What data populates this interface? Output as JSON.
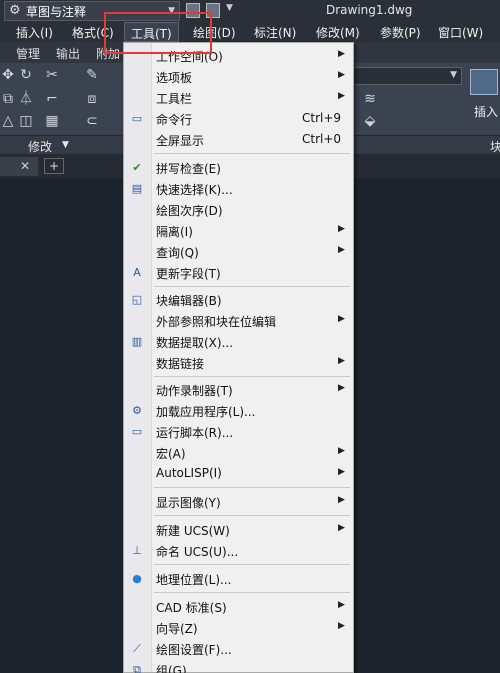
{
  "titlebar": {
    "workspace": "草图与注释",
    "document_title": "Drawing1.dwg"
  },
  "menubar": {
    "items": [
      "插入(I)",
      "格式(C)",
      "工具(T)",
      "绘图(D)",
      "标注(N)",
      "修改(M)",
      "参数(P)",
      "窗口(W)"
    ]
  },
  "ribbon_tabs": [
    "管理",
    "输出",
    "附加"
  ],
  "ribbon": {
    "panel_label": "修改",
    "insert_label": "插入",
    "right_panel_label": "块"
  },
  "tools_menu": {
    "items": [
      {
        "label": "工作空间(O)",
        "submenu": true
      },
      {
        "label": "选项板",
        "submenu": true
      },
      {
        "label": "工具栏",
        "submenu": true
      },
      {
        "label": "命令行",
        "shortcut": "Ctrl+9",
        "icon": "command-line-icon"
      },
      {
        "label": "全屏显示",
        "shortcut": "Ctrl+0"
      },
      {
        "label": "拼写检查(E)",
        "icon": "spell-check-icon"
      },
      {
        "label": "快速选择(K)...",
        "icon": "quick-select-icon"
      },
      {
        "label": "绘图次序(D)"
      },
      {
        "label": "隔离(I)",
        "submenu": true
      },
      {
        "label": "查询(Q)",
        "submenu": true
      },
      {
        "label": "更新字段(T)",
        "icon": "update-field-icon"
      },
      {
        "label": "块编辑器(B)",
        "icon": "block-editor-icon"
      },
      {
        "label": "外部参照和块在位编辑",
        "submenu": true
      },
      {
        "label": "数据提取(X)...",
        "icon": "data-extraction-icon"
      },
      {
        "label": "数据链接",
        "submenu": true
      },
      {
        "label": "动作录制器(T)",
        "submenu": true
      },
      {
        "label": "加载应用程序(L)...",
        "icon": "load-app-icon"
      },
      {
        "label": "运行脚本(R)...",
        "icon": "run-script-icon"
      },
      {
        "label": "宏(A)",
        "submenu": true
      },
      {
        "label": "AutoLISP(I)",
        "submenu": true
      },
      {
        "label": "显示图像(Y)",
        "submenu": true
      },
      {
        "label": "新建 UCS(W)",
        "submenu": true
      },
      {
        "label": "命名 UCS(U)...",
        "icon": "named-ucs-icon"
      },
      {
        "label": "地理位置(L)...",
        "icon": "globe-icon"
      },
      {
        "label": "CAD 标准(S)",
        "submenu": true
      },
      {
        "label": "向导(Z)",
        "submenu": true
      },
      {
        "label": "绘图设置(F)...",
        "icon": "drafting-settings-icon"
      },
      {
        "label": "组(G)",
        "icon": "group-icon"
      }
    ]
  }
}
